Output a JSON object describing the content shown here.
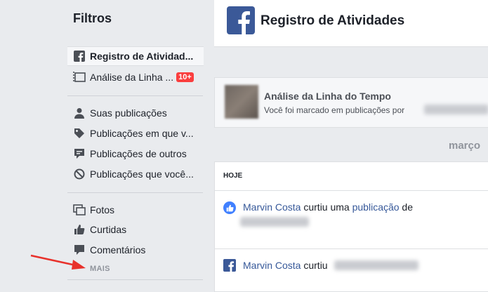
{
  "sidebar": {
    "title": "Filtros",
    "items": [
      {
        "label": "Registro de Atividad..."
      },
      {
        "label": "Análise da Linha ...",
        "badge": "10+"
      },
      {
        "label": "Suas publicações"
      },
      {
        "label": "Publicações em que v..."
      },
      {
        "label": "Publicações de outros"
      },
      {
        "label": "Publicações que você..."
      },
      {
        "label": "Fotos"
      },
      {
        "label": "Curtidas"
      },
      {
        "label": "Comentários"
      }
    ],
    "more_label": "MAIS"
  },
  "header": {
    "title": "Registro de Atividades"
  },
  "review": {
    "title": "Análise da Linha do Tempo",
    "subtitle": "Você foi marcado em publicações por"
  },
  "timeline": {
    "month": "março",
    "section_label": "HOJE",
    "activities": [
      {
        "actor": "Marvin Costa",
        "verb": " curtiu uma ",
        "object": "publicação",
        "suffix": " de"
      },
      {
        "actor": "Marvin Costa",
        "verb": " curtiu"
      }
    ]
  },
  "colors": {
    "brand": "#3b5998",
    "link": "#365899",
    "badge": "#fa3e3e",
    "arrow": "#e8312b"
  }
}
